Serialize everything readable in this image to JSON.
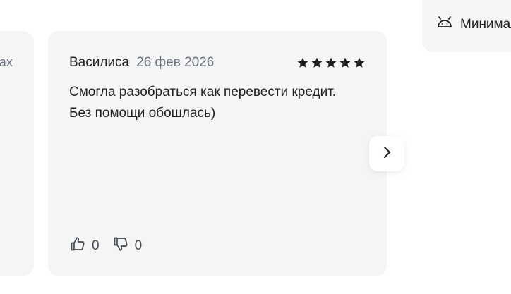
{
  "previous_card": {
    "peek_text": "ах"
  },
  "review": {
    "author": "Василиса",
    "date": "26 фев 2026",
    "rating": 5,
    "rating_max": 5,
    "text_line_1": "Смогла разобраться как перевести кредит.",
    "text_line_2": "Без помощи обошлась)",
    "likes": "0",
    "dislikes": "0"
  },
  "platform_chip": {
    "icon": "android-icon",
    "label": "Минимальная"
  },
  "navigation": {
    "next_icon": "chevron-right-icon"
  },
  "colors": {
    "card_background": "#f5f5f5",
    "text_primary": "#1f1f1f",
    "text_secondary": "#6b7480",
    "star": "#1f1f1f"
  }
}
